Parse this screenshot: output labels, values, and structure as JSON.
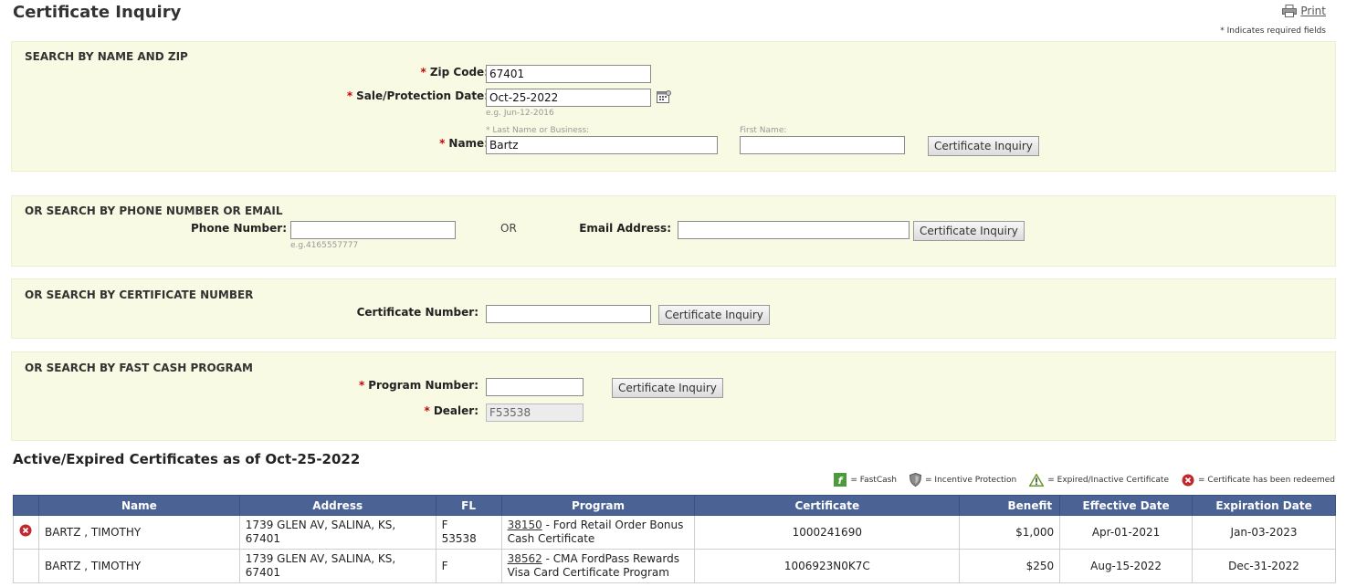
{
  "page": {
    "title": "Certificate Inquiry",
    "print_label": "Print",
    "required_note": "* Indicates required fields"
  },
  "name_zip": {
    "title": "SEARCH BY NAME AND ZIP",
    "zip_label": "Zip Code:",
    "zip_value": "67401",
    "date_label": "Sale/Protection Date:",
    "date_value": "Oct-25-2022",
    "date_hint": "e.g. Jun-12-2016",
    "name_label": "Name:",
    "last_name_hint": "* Last Name or Business:",
    "last_name_value": "Bartz",
    "first_name_hint": "First Name:",
    "first_name_value": "",
    "button": "Certificate Inquiry"
  },
  "phone_email": {
    "title": "OR SEARCH BY PHONE NUMBER OR EMAIL",
    "phone_label": "Phone Number:",
    "phone_value": "",
    "phone_hint": "e.g.4165557777",
    "or_text": "OR",
    "email_label": "Email Address:",
    "email_value": "",
    "button": "Certificate Inquiry"
  },
  "cert_number": {
    "title": "OR SEARCH BY CERTIFICATE NUMBER",
    "label": "Certificate Number:",
    "value": "",
    "button": "Certificate Inquiry"
  },
  "fast_cash": {
    "title": "OR SEARCH BY FAST CASH PROGRAM",
    "program_label": "Program Number:",
    "program_value": "",
    "dealer_label": "Dealer:",
    "dealer_value": "F53538",
    "button": "Certificate Inquiry"
  },
  "results": {
    "heading": "Active/Expired Certificates as of Oct-25-2022",
    "legend": [
      {
        "icon": "fastcash-icon",
        "label": "= FastCash",
        "color": "#4c9a3c"
      },
      {
        "icon": "shield-icon",
        "label": "= Incentive Protection",
        "color": "#777777"
      },
      {
        "icon": "warning-icon",
        "label": "= Expired/Inactive Certificate",
        "color": "#6a9a2a"
      },
      {
        "icon": "redeemed-icon",
        "label": "= Certificate has been redeemed",
        "color": "#c0282d"
      }
    ],
    "columns": [
      "Name",
      "Address",
      "FL",
      "Program",
      "Certificate",
      "Benefit",
      "Effective Date",
      "Expiration Date"
    ],
    "rows": [
      {
        "status_icon": "redeemed-icon",
        "name": "BARTZ , TIMOTHY",
        "address_line1": "1739 GLEN AV, SALINA, KS,",
        "address_line2": "67401",
        "fl_line1": "F",
        "fl_line2": "53538",
        "program_number": "38150",
        "program_desc_line1": " - Ford Retail Order Bonus",
        "program_desc_line2": "Cash Certificate",
        "certificate": "1000241690",
        "benefit": "$1,000",
        "effective": "Apr-01-2021",
        "expiration": "Jan-03-2023"
      },
      {
        "status_icon": "",
        "name": "BARTZ , TIMOTHY",
        "address_line1": "1739 GLEN AV, SALINA, KS,",
        "address_line2": "67401",
        "fl_line1": "F",
        "fl_line2": "",
        "program_number": "38562",
        "program_desc_line1": " - CMA FordPass Rewards",
        "program_desc_line2": "Visa Card Certificate Program",
        "certificate": "1006923N0K7C",
        "benefit": "$250",
        "effective": "Aug-15-2022",
        "expiration": "Dec-31-2022"
      }
    ]
  },
  "colors": {
    "panel_bg": "#f9fae3",
    "header_bg": "#4a6394",
    "required": "#c00000"
  }
}
